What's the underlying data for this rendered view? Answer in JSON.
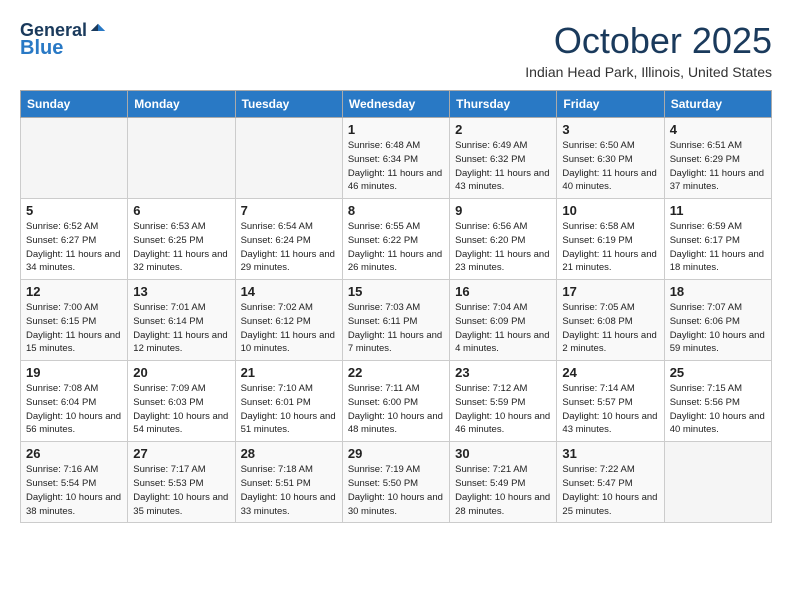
{
  "header": {
    "logo_general": "General",
    "logo_blue": "Blue",
    "title": "October 2025",
    "location": "Indian Head Park, Illinois, United States"
  },
  "days_of_week": [
    "Sunday",
    "Monday",
    "Tuesday",
    "Wednesday",
    "Thursday",
    "Friday",
    "Saturday"
  ],
  "weeks": [
    [
      {
        "day": "",
        "info": ""
      },
      {
        "day": "",
        "info": ""
      },
      {
        "day": "",
        "info": ""
      },
      {
        "day": "1",
        "info": "Sunrise: 6:48 AM\nSunset: 6:34 PM\nDaylight: 11 hours and 46 minutes."
      },
      {
        "day": "2",
        "info": "Sunrise: 6:49 AM\nSunset: 6:32 PM\nDaylight: 11 hours and 43 minutes."
      },
      {
        "day": "3",
        "info": "Sunrise: 6:50 AM\nSunset: 6:30 PM\nDaylight: 11 hours and 40 minutes."
      },
      {
        "day": "4",
        "info": "Sunrise: 6:51 AM\nSunset: 6:29 PM\nDaylight: 11 hours and 37 minutes."
      }
    ],
    [
      {
        "day": "5",
        "info": "Sunrise: 6:52 AM\nSunset: 6:27 PM\nDaylight: 11 hours and 34 minutes."
      },
      {
        "day": "6",
        "info": "Sunrise: 6:53 AM\nSunset: 6:25 PM\nDaylight: 11 hours and 32 minutes."
      },
      {
        "day": "7",
        "info": "Sunrise: 6:54 AM\nSunset: 6:24 PM\nDaylight: 11 hours and 29 minutes."
      },
      {
        "day": "8",
        "info": "Sunrise: 6:55 AM\nSunset: 6:22 PM\nDaylight: 11 hours and 26 minutes."
      },
      {
        "day": "9",
        "info": "Sunrise: 6:56 AM\nSunset: 6:20 PM\nDaylight: 11 hours and 23 minutes."
      },
      {
        "day": "10",
        "info": "Sunrise: 6:58 AM\nSunset: 6:19 PM\nDaylight: 11 hours and 21 minutes."
      },
      {
        "day": "11",
        "info": "Sunrise: 6:59 AM\nSunset: 6:17 PM\nDaylight: 11 hours and 18 minutes."
      }
    ],
    [
      {
        "day": "12",
        "info": "Sunrise: 7:00 AM\nSunset: 6:15 PM\nDaylight: 11 hours and 15 minutes."
      },
      {
        "day": "13",
        "info": "Sunrise: 7:01 AM\nSunset: 6:14 PM\nDaylight: 11 hours and 12 minutes."
      },
      {
        "day": "14",
        "info": "Sunrise: 7:02 AM\nSunset: 6:12 PM\nDaylight: 11 hours and 10 minutes."
      },
      {
        "day": "15",
        "info": "Sunrise: 7:03 AM\nSunset: 6:11 PM\nDaylight: 11 hours and 7 minutes."
      },
      {
        "day": "16",
        "info": "Sunrise: 7:04 AM\nSunset: 6:09 PM\nDaylight: 11 hours and 4 minutes."
      },
      {
        "day": "17",
        "info": "Sunrise: 7:05 AM\nSunset: 6:08 PM\nDaylight: 11 hours and 2 minutes."
      },
      {
        "day": "18",
        "info": "Sunrise: 7:07 AM\nSunset: 6:06 PM\nDaylight: 10 hours and 59 minutes."
      }
    ],
    [
      {
        "day": "19",
        "info": "Sunrise: 7:08 AM\nSunset: 6:04 PM\nDaylight: 10 hours and 56 minutes."
      },
      {
        "day": "20",
        "info": "Sunrise: 7:09 AM\nSunset: 6:03 PM\nDaylight: 10 hours and 54 minutes."
      },
      {
        "day": "21",
        "info": "Sunrise: 7:10 AM\nSunset: 6:01 PM\nDaylight: 10 hours and 51 minutes."
      },
      {
        "day": "22",
        "info": "Sunrise: 7:11 AM\nSunset: 6:00 PM\nDaylight: 10 hours and 48 minutes."
      },
      {
        "day": "23",
        "info": "Sunrise: 7:12 AM\nSunset: 5:59 PM\nDaylight: 10 hours and 46 minutes."
      },
      {
        "day": "24",
        "info": "Sunrise: 7:14 AM\nSunset: 5:57 PM\nDaylight: 10 hours and 43 minutes."
      },
      {
        "day": "25",
        "info": "Sunrise: 7:15 AM\nSunset: 5:56 PM\nDaylight: 10 hours and 40 minutes."
      }
    ],
    [
      {
        "day": "26",
        "info": "Sunrise: 7:16 AM\nSunset: 5:54 PM\nDaylight: 10 hours and 38 minutes."
      },
      {
        "day": "27",
        "info": "Sunrise: 7:17 AM\nSunset: 5:53 PM\nDaylight: 10 hours and 35 minutes."
      },
      {
        "day": "28",
        "info": "Sunrise: 7:18 AM\nSunset: 5:51 PM\nDaylight: 10 hours and 33 minutes."
      },
      {
        "day": "29",
        "info": "Sunrise: 7:19 AM\nSunset: 5:50 PM\nDaylight: 10 hours and 30 minutes."
      },
      {
        "day": "30",
        "info": "Sunrise: 7:21 AM\nSunset: 5:49 PM\nDaylight: 10 hours and 28 minutes."
      },
      {
        "day": "31",
        "info": "Sunrise: 7:22 AM\nSunset: 5:47 PM\nDaylight: 10 hours and 25 minutes."
      },
      {
        "day": "",
        "info": ""
      }
    ]
  ]
}
